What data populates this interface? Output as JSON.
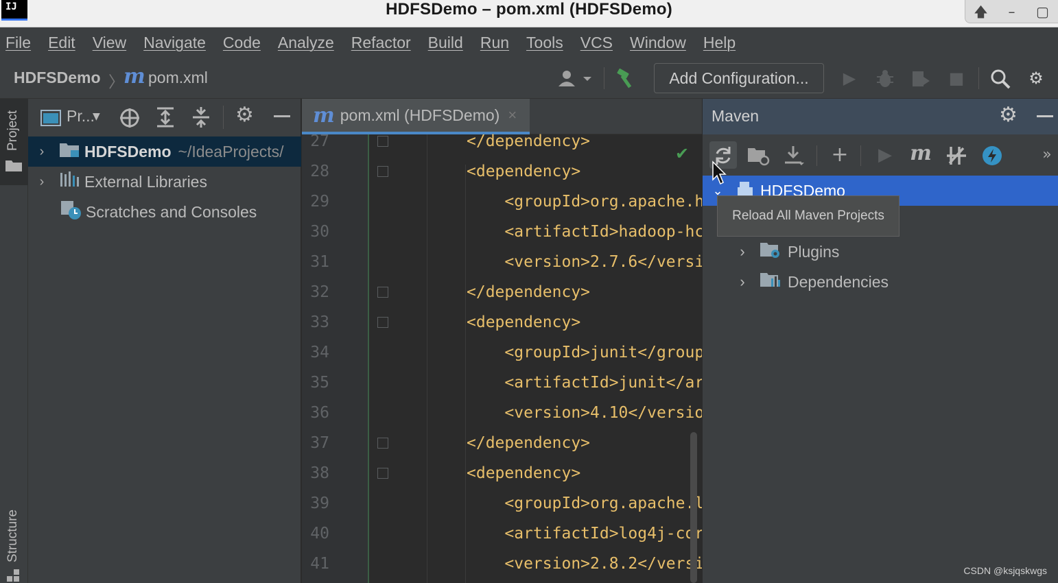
{
  "window": {
    "title": "HDFSDemo – pom.xml (HDFSDemo)",
    "app_icon_text": "IJ"
  },
  "menu": [
    "File",
    "Edit",
    "View",
    "Navigate",
    "Code",
    "Analyze",
    "Refactor",
    "Build",
    "Run",
    "Tools",
    "VCS",
    "Window",
    "Help"
  ],
  "breadcrumb": {
    "project": "HDFSDemo",
    "file_icon": "m",
    "file": "pom.xml"
  },
  "toolbar": {
    "add_configuration_label": "Add Configuration..."
  },
  "side_stripe": {
    "project_label": "Project",
    "structure_label": "Structure"
  },
  "project_panel": {
    "view_label": "Pr...",
    "tree": [
      {
        "label": "HDFSDemo",
        "path": "~/IdeaProjects/",
        "selected": true
      },
      {
        "label": "External Libraries"
      },
      {
        "label": "Scratches and Consoles"
      }
    ]
  },
  "editor": {
    "tab_icon": "m",
    "tab_label": "pom.xml (HDFSDemo)",
    "lines": [
      {
        "num": "27",
        "text": "</dependency>"
      },
      {
        "num": "28",
        "text": "<dependency>"
      },
      {
        "num": "29",
        "text": "    <groupId>org.apache.h"
      },
      {
        "num": "30",
        "text": "    <artifactId>hadoop-hc"
      },
      {
        "num": "31",
        "text": "    <version>2.7.6</versi"
      },
      {
        "num": "32",
        "text": "</dependency>"
      },
      {
        "num": "33",
        "text": "<dependency>"
      },
      {
        "num": "34",
        "text": "    <groupId>junit</group"
      },
      {
        "num": "35",
        "text": "    <artifactId>junit</ar"
      },
      {
        "num": "36",
        "text": "    <version>4.10</versio"
      },
      {
        "num": "37",
        "text": "</dependency>"
      },
      {
        "num": "38",
        "text": "<dependency>"
      },
      {
        "num": "39",
        "text": "    <groupId>org.apache.l"
      },
      {
        "num": "40",
        "text": "    <artifactId>log4j-cor"
      },
      {
        "num": "41",
        "text": "    <version>2.8.2</versi"
      }
    ]
  },
  "maven": {
    "title": "Maven",
    "tree": [
      {
        "label": "HDFSDemo",
        "selected": true
      },
      {
        "label": "Plugins"
      },
      {
        "label": "Dependencies"
      }
    ],
    "tooltip": "Reload All Maven Projects"
  },
  "watermark": "CSDN @ksjqskwgs",
  "colors": {
    "accent": "#2f65ca",
    "xml_tag": "#e8bf6a",
    "build_hammer": "#499c54",
    "check": "#499c54"
  }
}
